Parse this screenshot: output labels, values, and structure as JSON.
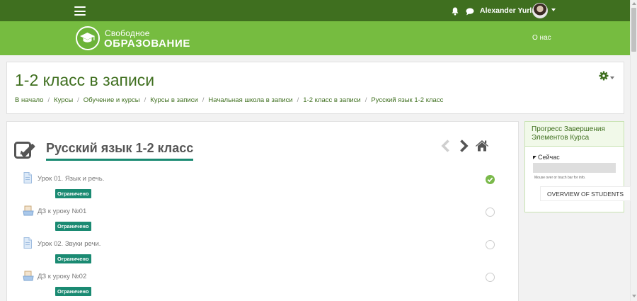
{
  "topbar": {
    "user_name": "Alexander Yurlaev",
    "bell_icon": "bell-icon",
    "chat_icon": "chat-bubble-icon"
  },
  "header": {
    "logo_line1": "Свободное",
    "logo_line2": "ОБРАЗОВАНИЕ",
    "about_link": "О нас"
  },
  "page": {
    "title": "1-2 класс в записи",
    "breadcrumb": [
      "В начало",
      "Курсы",
      "Обучение и курсы",
      "Курсы в записи",
      "Начальная школа в записи",
      "1-2 класс в записи",
      "Русский язык 1-2 класс"
    ]
  },
  "course": {
    "title": "Русский язык 1-2 класс",
    "activities": [
      {
        "name": "Урок 01. Язык и речь.",
        "type": "page",
        "badge": "Ограничено",
        "completed": true
      },
      {
        "name": "ДЗ к уроку №01",
        "type": "assignment",
        "badge": "Ограничено",
        "completed": false
      },
      {
        "name": "Урок 02. Звуки речи.",
        "type": "page",
        "badge": "Ограничено",
        "completed": false
      },
      {
        "name": "ДЗ к уроку №02",
        "type": "assignment",
        "badge": "Ограничено",
        "completed": false
      }
    ]
  },
  "progress_block": {
    "title": "Прогресс Завершения Элементов Курса",
    "now_label": "Сейчас",
    "progress_fraction": 0,
    "hint": "Mouse over or touch bar for info.",
    "overview_button": "OVERVIEW OF STUDENTS"
  },
  "colors": {
    "topbar": "#3f6f1f",
    "header": "#76bc40",
    "accent": "#1a8a72",
    "complete": "#7ab94a"
  }
}
